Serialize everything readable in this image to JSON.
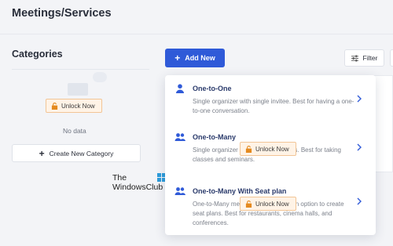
{
  "header": {
    "title": "Meetings/Services"
  },
  "categories": {
    "title": "Categories",
    "empty_text": "No data",
    "unlock_label": "Unlock Now",
    "create_label": "Create New Category"
  },
  "toolbar": {
    "add_label": "Add New",
    "filter_label": "Filter"
  },
  "watermark": {
    "line1": "The",
    "line2": "WindowsClub"
  },
  "dropdown": {
    "unlock_label": "Unlock Now",
    "options": [
      {
        "title": "One-to-One",
        "desc": "Single organizer with single invitee. Best for having a one-to-one conversation.",
        "icon": "single-user-icon"
      },
      {
        "title": "One-to-Many",
        "desc": "Single organizer with multiple invitees. Best for taking classes and seminars.",
        "icon": "group-icon"
      },
      {
        "title": "One-to-Many With Seat plan",
        "desc": "One-to-Many meeting with a seat plan option to create seat plans. Best for restaurants, cinema halls, and conferences.",
        "icon": "group-icon"
      }
    ]
  },
  "colors": {
    "primary": "#2f5ad8",
    "unlock_bg": "#fff3e6",
    "unlock_border": "#f2c596",
    "title": "#2a3a6b"
  }
}
